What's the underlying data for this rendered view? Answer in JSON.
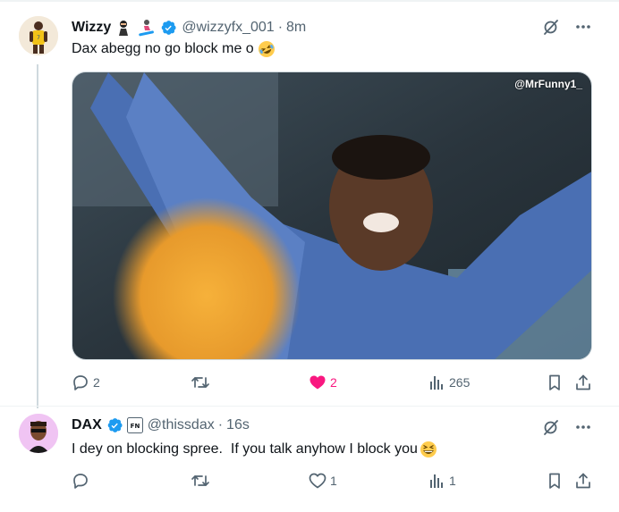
{
  "tweets": [
    {
      "name": "Wizzy",
      "badge_emojis": [
        "ninja",
        "snowboarder"
      ],
      "handle": "@wizzyfx_001",
      "separator": "·",
      "time": "8m",
      "text": "Dax abegg no go block me o",
      "text_emoji": "rolling-on-floor-laughing",
      "media": {
        "watermark": "@MrFunny1_"
      },
      "stats": {
        "replies": "2",
        "retweets": "",
        "likes": "2",
        "views": "265"
      },
      "liked": true
    },
    {
      "name": "DAX",
      "badge": "affiliate-badge",
      "handle": "@thissdax",
      "separator": "·",
      "time": "16s",
      "text": "I dey on blocking spree.  If you talk anyhow I block you",
      "text_emoji": "grinning-squinting-face",
      "stats": {
        "replies": "",
        "retweets": "",
        "likes": "1",
        "views": "1"
      },
      "liked": false
    }
  ],
  "colors": {
    "verified": "#1d9bf0",
    "like_active": "#f91880",
    "secondary_text": "#536471",
    "thread_line": "#cfd9de"
  }
}
